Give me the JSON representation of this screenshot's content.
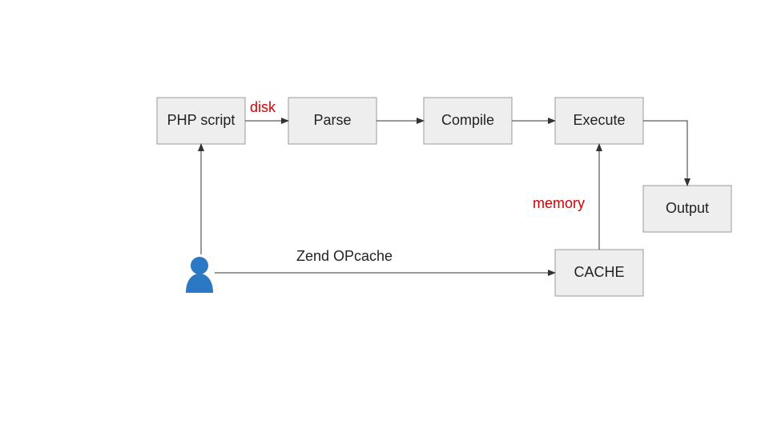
{
  "boxes": {
    "php": {
      "label": "PHP script"
    },
    "parse": {
      "label": "Parse"
    },
    "compile": {
      "label": "Compile"
    },
    "execute": {
      "label": "Execute"
    },
    "output": {
      "label": "Output"
    },
    "cache": {
      "label": "CACHE"
    }
  },
  "edges": {
    "disk": {
      "label": "disk"
    },
    "memory": {
      "label": "memory"
    },
    "opcache": {
      "label": "Zend OPcache"
    }
  }
}
